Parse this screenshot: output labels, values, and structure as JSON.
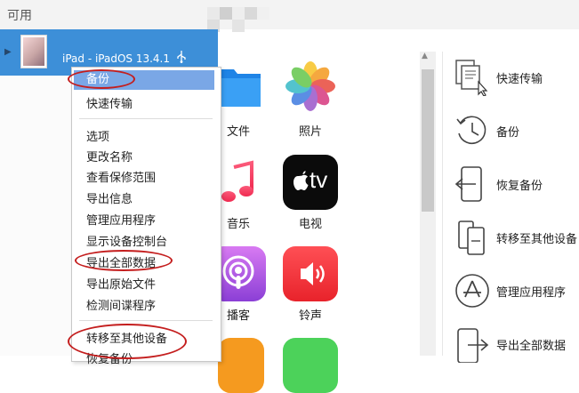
{
  "header": {
    "section_label": "可用"
  },
  "device": {
    "name": "iPad - iPadOS 13.4.1"
  },
  "context_menu": {
    "items": [
      {
        "label": "备份"
      },
      {
        "label": "快速传输"
      },
      {
        "label": "选项"
      },
      {
        "label": "更改名称"
      },
      {
        "label": "查看保修范围"
      },
      {
        "label": "导出信息"
      },
      {
        "label": "管理应用程序"
      },
      {
        "label": "显示设备控制台"
      },
      {
        "label": "导出全部数据"
      },
      {
        "label": "导出原始文件"
      },
      {
        "label": "检测间谍程序"
      },
      {
        "label": "转移至其他设备"
      },
      {
        "label": "恢复备份"
      }
    ]
  },
  "apps": [
    {
      "label": "文件",
      "icon": "files-icon"
    },
    {
      "label": "照片",
      "icon": "photos-icon"
    },
    {
      "label": "音乐",
      "icon": "music-icon"
    },
    {
      "label": "电视",
      "icon": "tv-icon"
    },
    {
      "label": "播客",
      "icon": "podcasts-icon"
    },
    {
      "label": "铃声",
      "icon": "ringtones-icon"
    }
  ],
  "tv_logo_text": "tv",
  "actions": [
    {
      "label": "快速传输"
    },
    {
      "label": "备份"
    },
    {
      "label": "恢复备份"
    },
    {
      "label": "转移至其他设备"
    },
    {
      "label": "管理应用程序"
    },
    {
      "label": "导出全部数据"
    }
  ],
  "colors": {
    "selection": "#3d8fd8",
    "menu_highlight": "#7aa7e6",
    "annotation_ring": "#c41e1e"
  }
}
